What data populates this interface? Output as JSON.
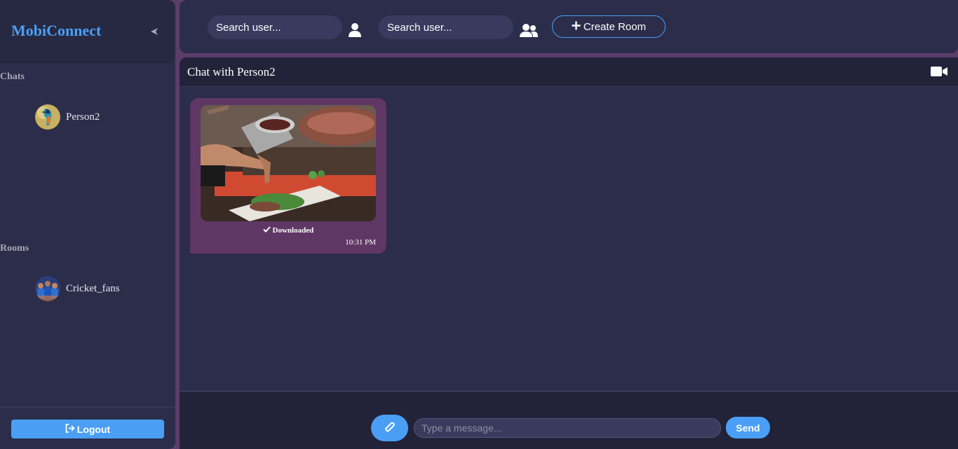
{
  "app": {
    "brand": "MobiConnect"
  },
  "colors": {
    "accent": "#4a9ff5",
    "bubble": "#5f3764",
    "panel": "#2b2d4a",
    "frame": "#5b3d6b"
  },
  "sidebar": {
    "collapse_icon": "chevron-left-icon",
    "chats_title": "Chats",
    "chats": [
      {
        "label": "Person2",
        "avatar": "kingfisher-avatar"
      }
    ],
    "rooms_title": "Rooms",
    "rooms": [
      {
        "label": "Cricket_fans",
        "avatar": "cricket-team-avatar"
      }
    ],
    "logout_label": "Logout",
    "logout_icon": "sign-out-icon"
  },
  "topbar": {
    "search_user_placeholder": "Search user...",
    "search_user_icon": "user-icon",
    "search_group_placeholder": "Search user...",
    "search_group_icon": "users-icon",
    "create_room_label": "Create Room",
    "create_room_icon": "plus-icon"
  },
  "chat": {
    "title": "Chat with Person2",
    "video_icon": "video-camera-icon",
    "messages": [
      {
        "type": "image",
        "image": "chef-plating-food-photo",
        "status": "Downloaded",
        "status_icon": "check-icon",
        "time": "10:31 PM"
      }
    ]
  },
  "composer": {
    "attach_icon": "paperclip-icon",
    "placeholder": "Type a message...",
    "send_label": "Send"
  }
}
